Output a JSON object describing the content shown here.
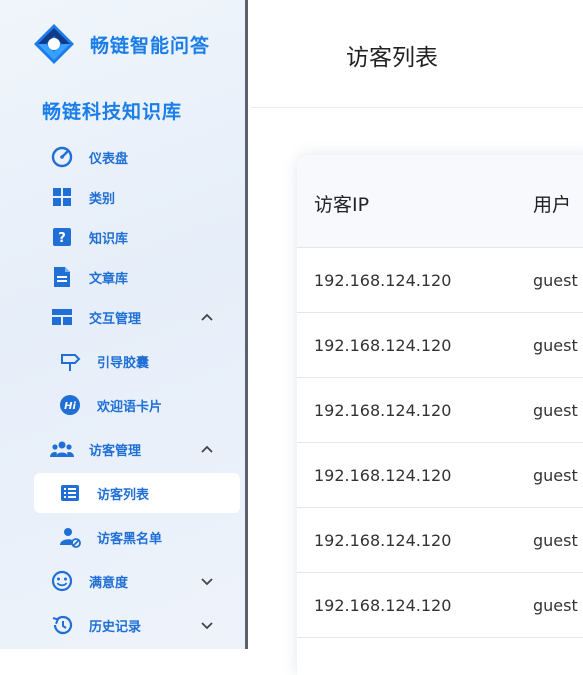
{
  "app": {
    "name": "畅链智能问答"
  },
  "sidebar": {
    "kb_title": "畅链科技知识库",
    "items": [
      {
        "label": "仪表盘",
        "icon": "dashboard-icon"
      },
      {
        "label": "类别",
        "icon": "grid-icon"
      },
      {
        "label": "知识库",
        "icon": "help-icon"
      },
      {
        "label": "文章库",
        "icon": "document-icon"
      },
      {
        "label": "交互管理",
        "icon": "layout-icon",
        "expanded": true
      },
      {
        "label": "引导胶囊",
        "icon": "signpost-icon"
      },
      {
        "label": "欢迎语卡片",
        "icon": "hi-icon",
        "icon_text": "Hi"
      },
      {
        "label": "访客管理",
        "icon": "group-icon",
        "expanded": true
      },
      {
        "label": "访客列表",
        "icon": "list-icon",
        "active": true
      },
      {
        "label": "访客黑名单",
        "icon": "user-block-icon"
      },
      {
        "label": "满意度",
        "icon": "smile-icon",
        "expanded": false
      },
      {
        "label": "历史记录",
        "icon": "history-icon",
        "expanded": false
      }
    ]
  },
  "page": {
    "title": "访客列表"
  },
  "table": {
    "columns": [
      "访客IP",
      "用户"
    ],
    "rows": [
      [
        "192.168.124.120",
        "guest"
      ],
      [
        "192.168.124.120",
        "guest"
      ],
      [
        "192.168.124.120",
        "guest"
      ],
      [
        "192.168.124.120",
        "guest"
      ],
      [
        "192.168.124.120",
        "guest"
      ],
      [
        "192.168.124.120",
        "guest"
      ]
    ]
  },
  "colors": {
    "accent": "#1a7de8",
    "nav_text": "#1f6fd6",
    "logo_dark": "#123a8a"
  }
}
